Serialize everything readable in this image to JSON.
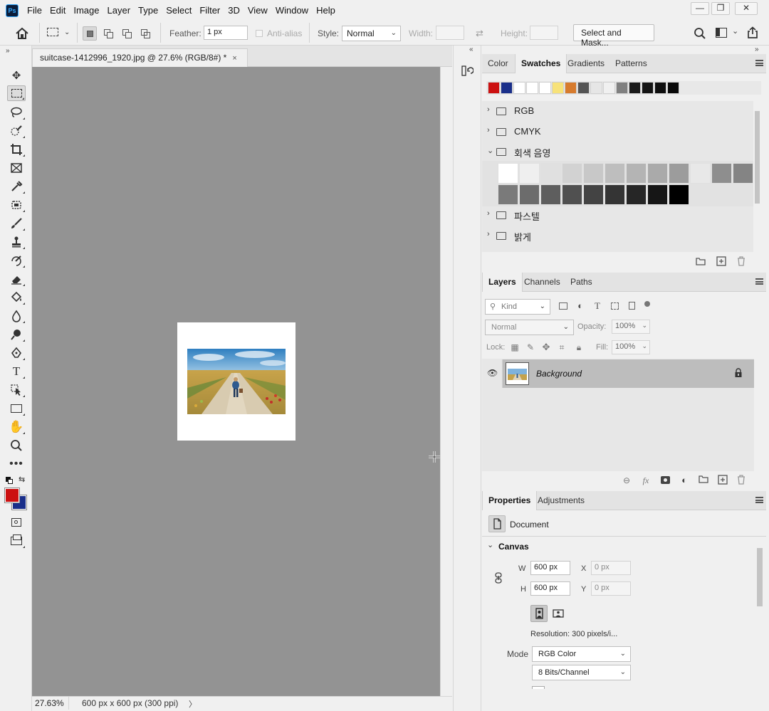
{
  "menubar": {
    "logo": "Ps",
    "items": [
      "File",
      "Edit",
      "Image",
      "Layer",
      "Type",
      "Select",
      "Filter",
      "3D",
      "View",
      "Window",
      "Help"
    ],
    "window_controls": {
      "minimize": "—",
      "restore": "❐",
      "close": "✕"
    }
  },
  "options": {
    "feather_label": "Feather:",
    "feather_value": "1 px",
    "antialias_label": "Anti-alias",
    "style_label": "Style:",
    "style_value": "Normal",
    "width_label": "Width:",
    "height_label": "Height:",
    "select_mask_label": "Select and Mask..."
  },
  "document": {
    "tab_title": "suitcase-1412996_1920.jpg @ 27.6% (RGB/8#) *",
    "tab_close": "×",
    "zoom": "27.63%",
    "info": "600 px x 600 px (300 ppi)",
    "status_arrow": "〉"
  },
  "swatches_panel": {
    "tabs": [
      "Color",
      "Swatches",
      "Gradients",
      "Patterns"
    ],
    "active_tab": "Swatches",
    "recent_colors": [
      "#cc1111",
      "#1a2f8a",
      "#ffffff",
      "#ffffff",
      "#ffffff",
      "#f7e27a",
      "#d77b2d",
      "#555555",
      "#e6e6e6",
      "#f0f0f0",
      "#808080",
      "#1a1a1a",
      "#141414",
      "#0f0f0f",
      "#0a0a0a"
    ],
    "folders": [
      {
        "name": "RGB",
        "expanded": false
      },
      {
        "name": "CMYK",
        "expanded": false
      },
      {
        "name": "회색 음영",
        "expanded": true
      },
      {
        "name": "파스텔",
        "expanded": false
      },
      {
        "name": "밝게",
        "expanded": false
      }
    ],
    "gray_row1": [
      "#ffffff",
      "#efefef",
      "#e0e0e0",
      "#d2d2d2",
      "#c8c8c8",
      "#bebebe",
      "#b4b4b4",
      "#aaaaaa",
      "#9c9c9c",
      "#e8e8e8",
      "#8e8e8e",
      "#848484"
    ],
    "gray_row2": [
      "#7a7a7a",
      "#6c6c6c",
      "#5e5e5e",
      "#505050",
      "#434343",
      "#343434",
      "#262626",
      "#161616",
      "#000000"
    ]
  },
  "layers_panel": {
    "tabs": [
      "Layers",
      "Channels",
      "Paths"
    ],
    "active_tab": "Layers",
    "filter_kind": "Kind",
    "blend_mode": "Normal",
    "opacity_label": "Opacity:",
    "opacity_value": "100%",
    "lock_label": "Lock:",
    "fill_label": "Fill:",
    "fill_value": "100%",
    "layers": [
      {
        "name": "Background",
        "visible": true,
        "locked": true
      }
    ]
  },
  "properties_panel": {
    "tabs": [
      "Properties",
      "Adjustments"
    ],
    "active_tab": "Properties",
    "doc_label": "Document",
    "section_canvas": "Canvas",
    "w_label": "W",
    "w_value": "600 px",
    "h_label": "H",
    "h_value": "600 px",
    "x_label": "X",
    "x_value": "0 px",
    "y_label": "Y",
    "y_value": "0 px",
    "resolution": "Resolution: 300 pixels/i...",
    "mode_label": "Mode",
    "mode_value": "RGB Color",
    "bits_value": "8 Bits/Channel"
  },
  "colors": {
    "foreground": "#cc1111",
    "background": "#1a2f8a",
    "canvas_bg": "#939393",
    "layer_selected": "#bdbdbd"
  }
}
